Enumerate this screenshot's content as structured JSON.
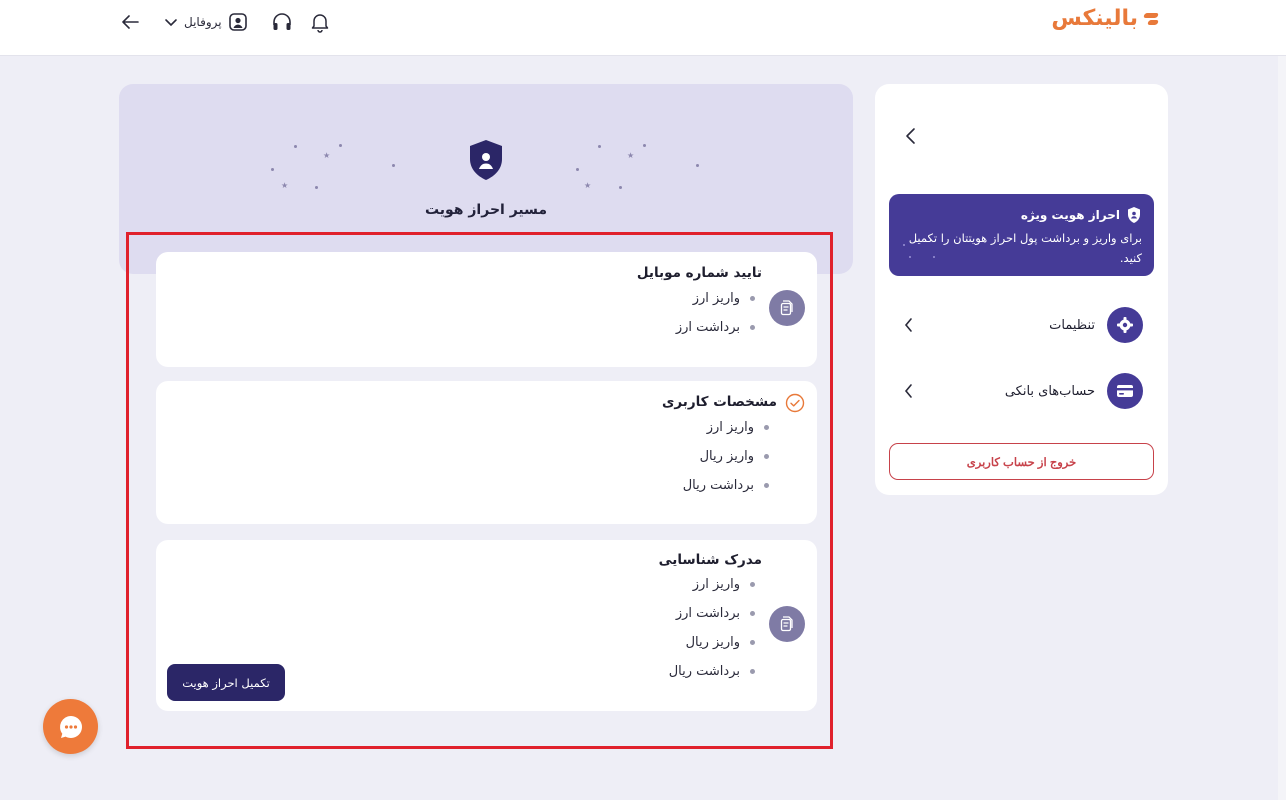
{
  "header": {
    "logo_text": "بالینکس",
    "profile_label": "پروفایل",
    "icons": [
      "arrow-left-icon",
      "chevron-down-icon",
      "user-square-icon",
      "headphones-icon",
      "bell-icon"
    ]
  },
  "sidebar": {
    "promo": {
      "title": "احراز هویت ویژه",
      "text": "برای واریز و برداشت پول احراز هویتتان را تکمیل کنید."
    },
    "items": [
      {
        "label": "تنظیمات",
        "icon": "gear-icon"
      },
      {
        "label": "حساب‌های بانکی",
        "icon": "bank-card-icon"
      }
    ],
    "logout_label": "خروج از حساب کاربری"
  },
  "main": {
    "hero_title": "مسیر احراز هویت",
    "cards": [
      {
        "title": "تایید شماره موبایل",
        "items": [
          "واریز ارز",
          "برداشت ارز"
        ],
        "icon": "document-icon"
      },
      {
        "title": "مشخصات کاربری",
        "items": [
          "واریز ارز",
          "واریز ریال",
          "برداشت ریال"
        ],
        "icon": "check-circle-icon"
      },
      {
        "title": "مدرک شناسایی",
        "items": [
          "واریز ارز",
          "برداشت ارز",
          "واریز ریال",
          "برداشت ریال"
        ],
        "icon": "document-icon"
      }
    ],
    "complete_button": "تکمیل احراز هویت"
  },
  "colors": {
    "brand_orange": "#E8793A",
    "primary_purple": "#453B97",
    "dark_navy": "#2B2667",
    "logout_red": "#C7424A",
    "highlight_red": "#E0212C"
  }
}
